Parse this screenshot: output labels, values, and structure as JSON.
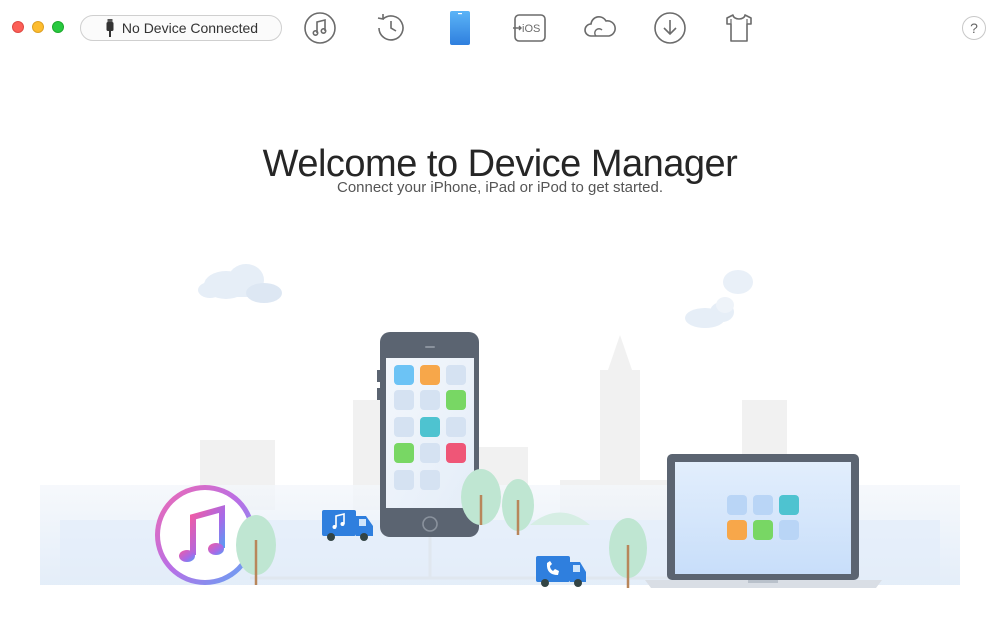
{
  "window": {
    "controls": [
      "close",
      "minimize",
      "maximize"
    ]
  },
  "device_selector": {
    "label": "No Device Connected",
    "icon": "cable-icon"
  },
  "toolbar": {
    "items": [
      {
        "name": "music-manager",
        "icon": "music-note-icon"
      },
      {
        "name": "backup-history",
        "icon": "history-clock-icon"
      },
      {
        "name": "device-manager",
        "icon": "phone-icon",
        "active": true
      },
      {
        "name": "ios-mover",
        "icon": "ios-transfer-icon",
        "label": "iOS"
      },
      {
        "name": "icloud-manager",
        "icon": "cloud-icon"
      },
      {
        "name": "downloader",
        "icon": "download-icon"
      },
      {
        "name": "toolkit",
        "icon": "shirt-icon"
      }
    ],
    "help_label": "?"
  },
  "welcome": {
    "title": "Welcome to Device Manager",
    "subtitle": "Connect your iPhone, iPad or iPod to get started."
  },
  "colors": {
    "accent": "#4a9bf0",
    "icon_gray": "#6b6b6b",
    "truck_blue": "#2f7fde",
    "tree_green": "#a8dcc4"
  }
}
